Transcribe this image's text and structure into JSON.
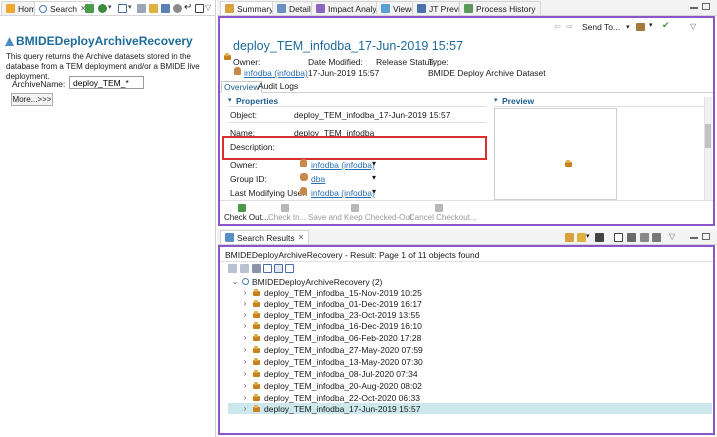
{
  "left_panel": {
    "tabs": [
      {
        "label": "Home"
      },
      {
        "label": "Search"
      }
    ],
    "title": "BMIDEDeployArchiveRecovery",
    "description": "This query returns the Archive datasets stored in the database from a TEM deployment and/or a BMIDE live deployment.",
    "field_label": "ArchiveName:",
    "field_value": "deploy_TEM_*",
    "more_button": "More...>>>"
  },
  "editor": {
    "tabs": [
      {
        "label": "Summary"
      },
      {
        "label": "Details"
      },
      {
        "label": "Impact Analysis"
      },
      {
        "label": "Viewer"
      },
      {
        "label": "JT Preview"
      },
      {
        "label": "Process History"
      }
    ],
    "send_to": "Send To...",
    "object_title": "deploy_TEM_infodba_17-Jun-2019 15:57",
    "header": {
      "owner_label": "Owner:",
      "owner_value": "infodba (infodba)",
      "date_label": "Date Modified:",
      "date_value": "17-Jun-2019 15:57",
      "release_label": "Release Status:",
      "type_label": "Type:",
      "type_value": "BMIDE Deploy Archive Dataset"
    },
    "subtabs": [
      {
        "label": "Overview"
      },
      {
        "label": "Audit Logs"
      }
    ],
    "properties_header": "Properties",
    "preview_header": "Preview",
    "properties": {
      "object_label": "Object:",
      "object_value": "deploy_TEM_infodba_17-Jun-2019 15:57",
      "name_label": "Name:",
      "name_value": "deploy_TEM_infodba",
      "description_label": "Description:",
      "owner_label": "Owner:",
      "owner_value": "infodba (infodba)",
      "group_label": "Group ID:",
      "group_value": "dba",
      "modifier_label": "Last Modifying User:",
      "modifier_value": "infodba (infodba)"
    },
    "actions": [
      {
        "label": "Check Out..."
      },
      {
        "label": "Check In..."
      },
      {
        "label": "Save and Keep Checked-Out"
      },
      {
        "label": "Cancel Checkout..."
      }
    ]
  },
  "results": {
    "tab_label": "Search Results",
    "summary": "BMIDEDeployArchiveRecovery - Result: Page 1 of 11 objects found",
    "root": "BMIDEDeployArchiveRecovery (2)",
    "items": [
      "deploy_TEM_infodba_15-Nov-2019 10:25",
      "deploy_TEM_infodba_01-Dec-2019 16:17",
      "deploy_TEM_infodba_23-Oct-2019 13:55",
      "deploy_TEM_infodba_16-Dec-2019 16:10",
      "deploy_TEM_infodba_06-Feb-2020 17:28",
      "deploy_TEM_infodba_27-May-2020 07:59",
      "deploy_TEM_infodba_13-May-2020 07:30",
      "deploy_TEM_infodba_08-Jul-2020 07:34",
      "deploy_TEM_infodba_20-Aug-2020 08:02",
      "deploy_TEM_infodba_22-Oct-2020 06:33",
      "deploy_TEM_infodba_17-Jun-2019 15:57"
    ],
    "selected_index": 10
  },
  "colors": {
    "editor_border": "#8a56c9",
    "description_highlight": "#d9302f",
    "selected_row": "#cde8ec",
    "link": "#2a6fb3"
  }
}
